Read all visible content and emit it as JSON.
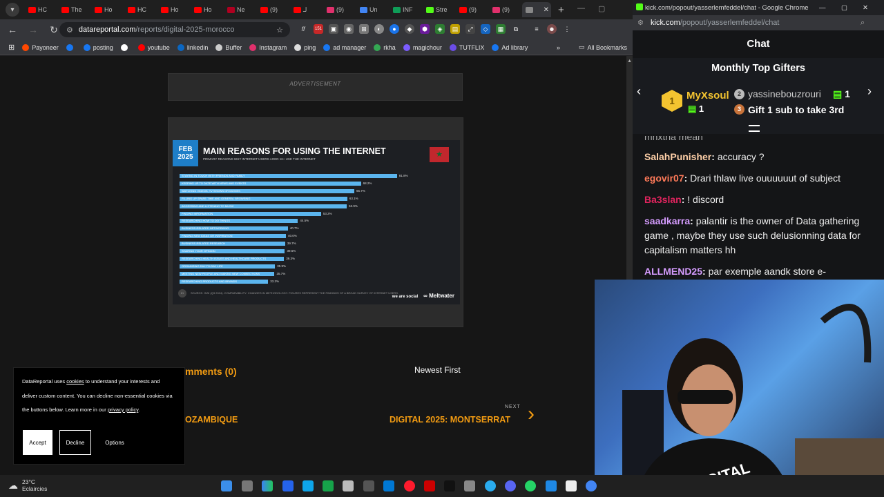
{
  "browser": {
    "tabs": [
      {
        "label": "HC",
        "color": "#ff0000"
      },
      {
        "label": "The",
        "color": "#ff0000"
      },
      {
        "label": "Ho",
        "color": "#ff0000"
      },
      {
        "label": "HC",
        "color": "#ff0000"
      },
      {
        "label": "Ho",
        "color": "#ff0000"
      },
      {
        "label": "Ho",
        "color": "#ff0000"
      },
      {
        "label": "Ne",
        "color": "#b00020"
      },
      {
        "label": "(9)",
        "color": "#ff0000"
      },
      {
        "label": "لـ",
        "color": "#ff0000"
      },
      {
        "label": "(9)",
        "color": "#e1306c"
      },
      {
        "label": "Un",
        "color": "#4285f4"
      },
      {
        "label": "INF",
        "color": "#0f9d58"
      },
      {
        "label": "Stre",
        "color": "#53fc18"
      },
      {
        "label": "(9)",
        "color": "#ff0000"
      },
      {
        "label": "(9)",
        "color": "#e1306c"
      },
      {
        "label": "",
        "color": "#888888"
      }
    ],
    "url_domain": "datareportal.com",
    "url_path": "/reports/digital-2025-morocco",
    "extension_badge": "151",
    "bookmarks": [
      {
        "label": "Payoneer",
        "color": "#ff4800"
      },
      {
        "label": "",
        "color": "#1877f2"
      },
      {
        "label": "posting",
        "color": "#1877f2"
      },
      {
        "label": "",
        "color": "#ffffff"
      },
      {
        "label": "youtube",
        "color": "#ff0000"
      },
      {
        "label": "linkedin",
        "color": "#0a66c2"
      },
      {
        "label": "Buffer",
        "color": "#cccccc"
      },
      {
        "label": "Instagram",
        "color": "#e1306c"
      },
      {
        "label": "ping",
        "color": "#dddddd"
      },
      {
        "label": "ad manager",
        "color": "#1877f2"
      },
      {
        "label": "rkha",
        "color": "#34a853"
      },
      {
        "label": "magichour",
        "color": "#7b5cff"
      },
      {
        "label": "TUTFLIX",
        "color": "#6b4de6"
      },
      {
        "label": "Ad library",
        "color": "#1877f2"
      }
    ],
    "all_bookmarks": "All Bookmarks"
  },
  "page": {
    "advertisement": "ADVERTISEMENT",
    "comments": "mments (0)",
    "newest_first": "Newest First",
    "next_label": "NEXT",
    "next_link": "DIGITAL 2025: MONTSERRAT",
    "prev_link": "OZAMBIQUE"
  },
  "slide": {
    "badge_line1": "FEB",
    "badge_line2": "2025",
    "title": "MAIN REASONS FOR USING THE INTERNET",
    "subtitle": "PRIMARY REASONS WHY INTERNET USERS AGED 16+ USE THE INTERNET",
    "source": "SOURCE: GWI (Q3 2024). COMPARABILITY: CHANGES IN METHODOLOGY. FIGURES REPRESENT THE FINDINGS OF A BROAD SURVEY OF INTERNET USERS.",
    "logo_left": "we are social",
    "logo_right": "Meltwater",
    "page_num": "81"
  },
  "chart_data": {
    "type": "bar",
    "title": "MAIN REASONS FOR USING THE INTERNET",
    "orientation": "horizontal",
    "categories": [
      "STAYING IN TOUCH WITH FRIENDS AND FAMILY",
      "KEEPING UP TO DATE WITH NEWS AND EVENTS",
      "WATCHING VIDEOS, TV SHOWS OR MOVIES",
      "FILLING UP SPARE TIME AND GENERAL BROWSING",
      "ACCESSING AND LISTENING TO MUSIC",
      "FINDING INFORMATION",
      "RESEARCHING HOW TO DO THINGS",
      "BUSINESS-RELATED NETWORKING",
      "FINDING NEW IDEAS OR INSPIRATION",
      "BUSINESS-RELATED RESEARCH",
      "SHARING YOUR OPINION",
      "RESEARCHING HEALTH ISSUES AND HEALTHCARE PRODUCTS",
      "ORGANISING DAY-TO-DAY LIFE",
      "MEETING NEW PEOPLE AND MAKING NEW CONNECTIONS",
      "RESEARCHING PRODUCTS AND BRANDS"
    ],
    "values": [
      81.8,
      68.2,
      65.7,
      63.1,
      62.9,
      53.2,
      44.5,
      40.7,
      40.0,
      39.7,
      39.6,
      39.3,
      35.9,
      35.7,
      33.3
    ],
    "unit": "%",
    "xlim": [
      0,
      100
    ]
  },
  "cookie": {
    "text_before": "DataReportal uses ",
    "link1": "cookies",
    "text_mid": " to understand your interests and deliver custom content. You can decline non-essential cookies via the buttons below. Learn more in our ",
    "link2": "privacy policy",
    "text_end": ".",
    "accept": "Accept",
    "decline": "Decline",
    "options": "Options"
  },
  "chat": {
    "window_title": "kick.com/popout/yasserlemfeddel/chat - Google Chrome",
    "url_domain": "kick.com",
    "url_path": "/popout/yasserlemfeddel/chat",
    "header": "Chat",
    "gifters_title": "Monthly Top Gifters",
    "gifter1_name": "MyXsoul",
    "gifter1_count": "1",
    "gifter1_rank": "1",
    "gifter2_name": "yassinebouzrouri",
    "gifter2_count": "1",
    "gifter2_rank": "2",
    "gifter3_rank": "3",
    "gifter3_text": "Gift 1 sub to take 3rd",
    "partial_top": "mnxtha mean",
    "messages": [
      {
        "user": "SalahPunisher",
        "color": "#ffd0a8",
        "text": " accuracy ?"
      },
      {
        "user": "egovir07",
        "color": "#ff7a59",
        "text": " Drari thlaw live ouuuuuut of subject"
      },
      {
        "user": "Ba3slan",
        "color": "#e0245e",
        "text": " ! discord"
      },
      {
        "user": "saadkarra",
        "color": "#d59cff",
        "text": " palantir is the owner of Data gathering game , maybe they use such delusionning data for capitalism matters hh"
      },
      {
        "user": "ALLMEND25",
        "color": "#d59cff",
        "text": " par exemple aandk store e-"
      }
    ]
  },
  "taskbar": {
    "temperature": "23°C",
    "weather": "Eclaircies"
  },
  "colors": {
    "accent_orange": "#f39c12",
    "chart_bar": "#5bb5ee",
    "badge_blue": "#1e7ec8",
    "kick_green": "#53fc18"
  }
}
